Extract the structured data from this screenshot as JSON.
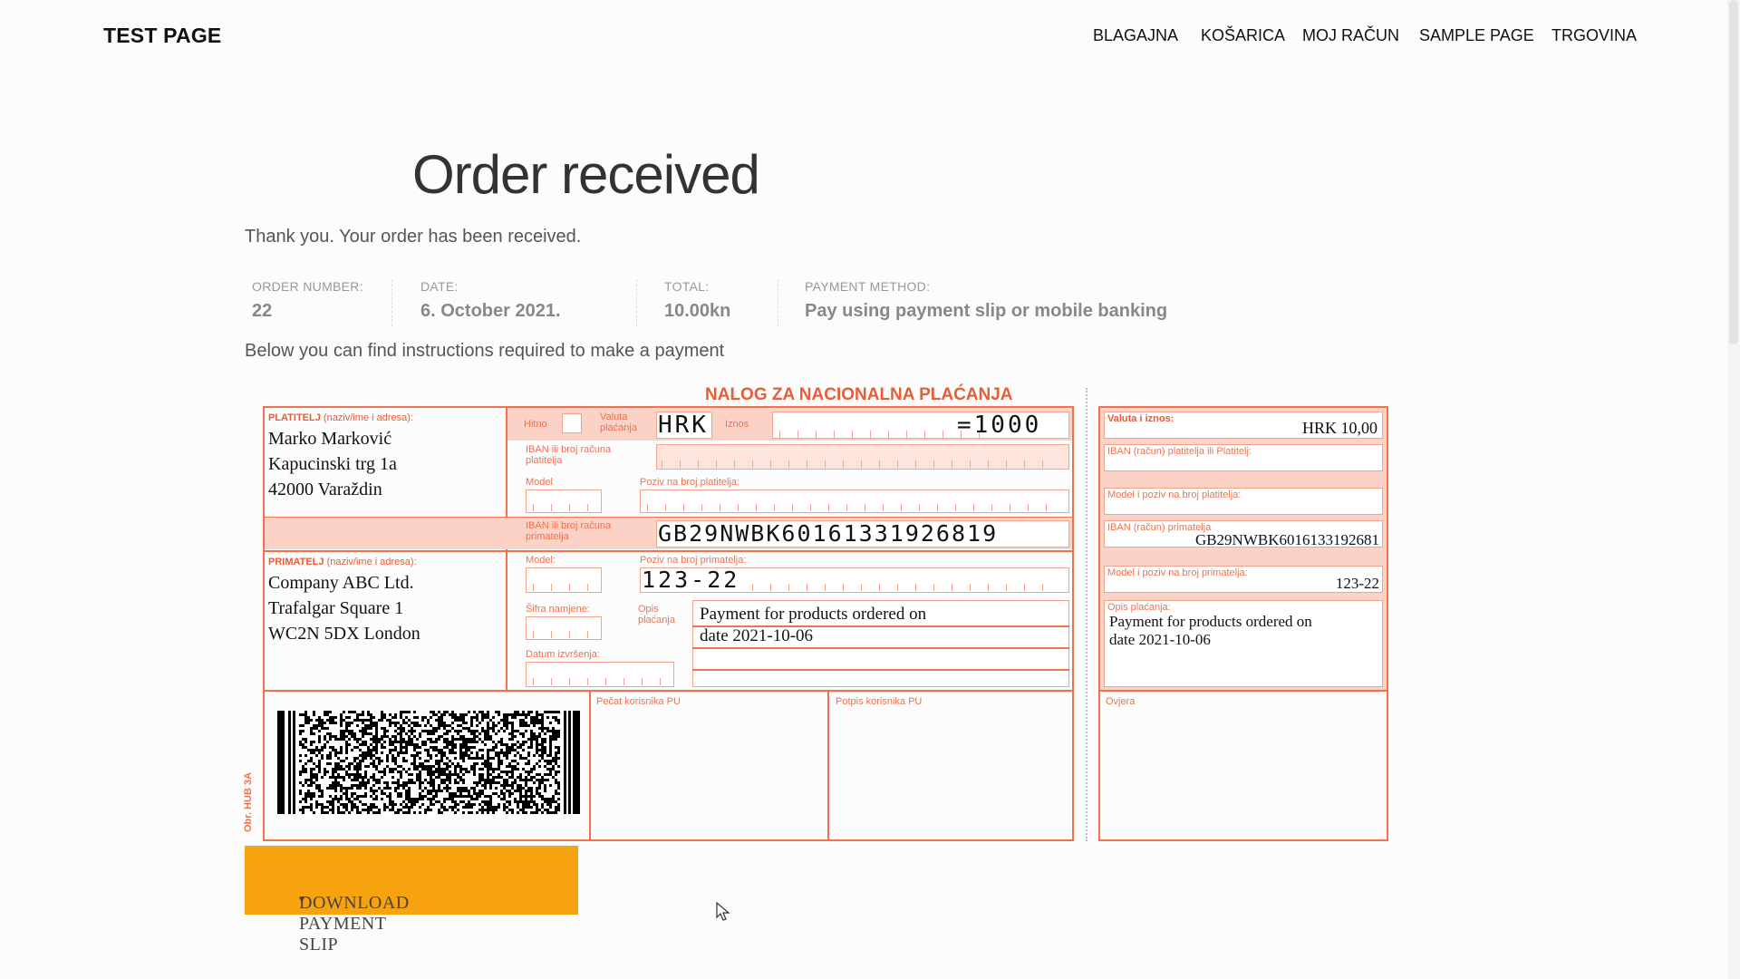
{
  "site": {
    "title": "TEST PAGE"
  },
  "nav": [
    "BLAGAJNA",
    "KOŠARICA",
    "MOJ RAČUN",
    "SAMPLE PAGE",
    "TRGOVINA"
  ],
  "page": {
    "title": "Order received",
    "thanks": "Thank you. Your order has been received.",
    "instructions": "Below you can find instructions required to make a payment"
  },
  "order": {
    "number_label": "ORDER NUMBER:",
    "number": "22",
    "date_label": "DATE:",
    "date": "6. October 2021.",
    "total_label": "TOTAL:",
    "total": "10.00kn",
    "method_label": "PAYMENT METHOD:",
    "method": "Pay using payment slip or mobile banking"
  },
  "slip": {
    "header": "NALOG ZA NACIONALNA PLAĆANJA",
    "payer_label": "PLATITELJ",
    "payer_sub": "(naziv/ime i adresa):",
    "payer_lines": [
      "Marko Marković",
      "Kapucinski trg 1a",
      "42000 Varaždin"
    ],
    "hitno_label": "Hitno",
    "valuta_label": "Valuta plaćanja",
    "currency": "HRK",
    "iznos_label": "Iznos",
    "amount": "=1000",
    "iban_payer_label": "IBAN ili broj računa platitelja",
    "model_label": "Model",
    "poziv_payer_label": "Poziv na broj platitelja:",
    "iban_recipient_label": "IBAN ili broj računa primatelja",
    "iban_recipient": "GB29NWBK60161331926819",
    "recipient_label": "PRIMATELJ",
    "recipient_sub": "(naziv/ime i adresa):",
    "recipient_lines": [
      "Company ABC Ltd.",
      "Trafalgar Square 1",
      "WC2N 5DX London"
    ],
    "model2_label": "Model:",
    "poziv_recipient_label": "Poziv na broj primatelja:",
    "reference": "123-22",
    "sifra_label": "Šifra namjene:",
    "opis_label": "Opis plaćanja",
    "description_lines": [
      "Payment for products ordered on",
      "date 2021-10-06"
    ],
    "datum_label": "Datum izvršenja:",
    "pecat_label": "Pečat korisnika PU",
    "potpis_label": "Potpis korisnika PU",
    "form_code": "Obr. HUB 3A",
    "r_valuta_label": "Valuta i iznos:",
    "r_amount": "HRK 10,00",
    "r_iban_payer_label": "IBAN (račun) platitelja ili Platitelj:",
    "r_model_payer_label": "Model i poziv na broj platitelja:",
    "r_iban_recipient_label": "IBAN (račun) primatelja",
    "r_iban_recipient": "GB29NWBK6016133192681",
    "r_model_recipient_label": "Model i poziv na broj primatelja:",
    "r_reference": "123-22",
    "r_opis_label": "Opis plaćanja:",
    "r_description_lines": [
      "Payment for products ordered on",
      "date 2021-10-06"
    ],
    "r_ovjera_label": "Ovjera"
  },
  "download": {
    "label": "DOWNLOAD PAYMENT SLIP"
  },
  "colors": {
    "accent": "#f0714d",
    "button": "#f7a310",
    "slip_fill": "#fbd2c5"
  }
}
